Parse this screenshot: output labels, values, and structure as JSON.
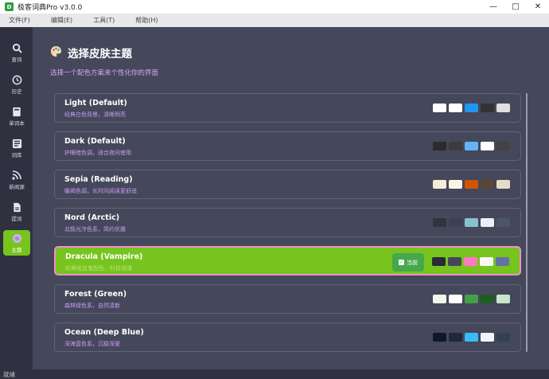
{
  "window": {
    "title": "极客词典Pro v3.0.0",
    "app_icon": "D"
  },
  "menu": [
    "文件(F)",
    "编辑(E)",
    "工具(T)",
    "帮助(H)"
  ],
  "sidebar": [
    {
      "label": "查词",
      "icon": "search-icon"
    },
    {
      "label": "历史",
      "icon": "history-icon"
    },
    {
      "label": "单词本",
      "icon": "book-icon"
    },
    {
      "label": "词库",
      "icon": "library-icon"
    },
    {
      "label": "新闻源",
      "icon": "rss-icon"
    },
    {
      "label": "提词",
      "icon": "document-icon"
    },
    {
      "label": "主题",
      "icon": "theme-icon",
      "active": true
    }
  ],
  "main": {
    "title": "选择皮肤主题",
    "subtitle": "选择一个配色方案来个性化你的界面",
    "current_badge": "当前",
    "themes": [
      {
        "name": "Light (Default)",
        "desc": "经典白色背景，清晰明亮",
        "swatches": [
          "#ffffff",
          "#ffffff",
          "#2196f3",
          "#333333",
          "#e0e0e0"
        ]
      },
      {
        "name": "Dark (Default)",
        "desc": "护眼暗色调，适合夜间使用",
        "swatches": [
          "#2b2b2b",
          "#3c3c3c",
          "#64b5f6",
          "#ffffff",
          "#424242"
        ]
      },
      {
        "name": "Sepia (Reading)",
        "desc": "暖褐色调，长时间阅读更舒适",
        "swatches": [
          "#f4ecd8",
          "#faf4e6",
          "#d35400",
          "#5b4636",
          "#e6dcc6"
        ]
      },
      {
        "name": "Nord (Arctic)",
        "desc": "北极光冷色系，简约优雅",
        "swatches": [
          "#2e3440",
          "#3b4252",
          "#88c0d0",
          "#eceff4",
          "#4c566a"
        ]
      },
      {
        "name": "Dracula (Vampire)",
        "desc": "经典吸血鬼配色，科技感强",
        "swatches": [
          "#282a36",
          "#44475a",
          "#ff79c6",
          "#f8f8f2",
          "#6272a4"
        ],
        "active": true
      },
      {
        "name": "Forest (Green)",
        "desc": "森林绿色系，自然清新",
        "swatches": [
          "#f1f8e9",
          "#ffffff",
          "#43a047",
          "#1b5e20",
          "#c8e6c9"
        ]
      },
      {
        "name": "Ocean (Deep Blue)",
        "desc": "深海蓝色系，沉稳深邃",
        "swatches": [
          "#0f172a",
          "#1e293b",
          "#38bdf8",
          "#f1f5f9",
          "#334155"
        ]
      }
    ]
  },
  "status": "就绪",
  "colors": {
    "accent": "#76c41d",
    "sidebar_bg": "#2f3140",
    "main_bg": "#45475a",
    "active_border": "#f48fd0"
  }
}
